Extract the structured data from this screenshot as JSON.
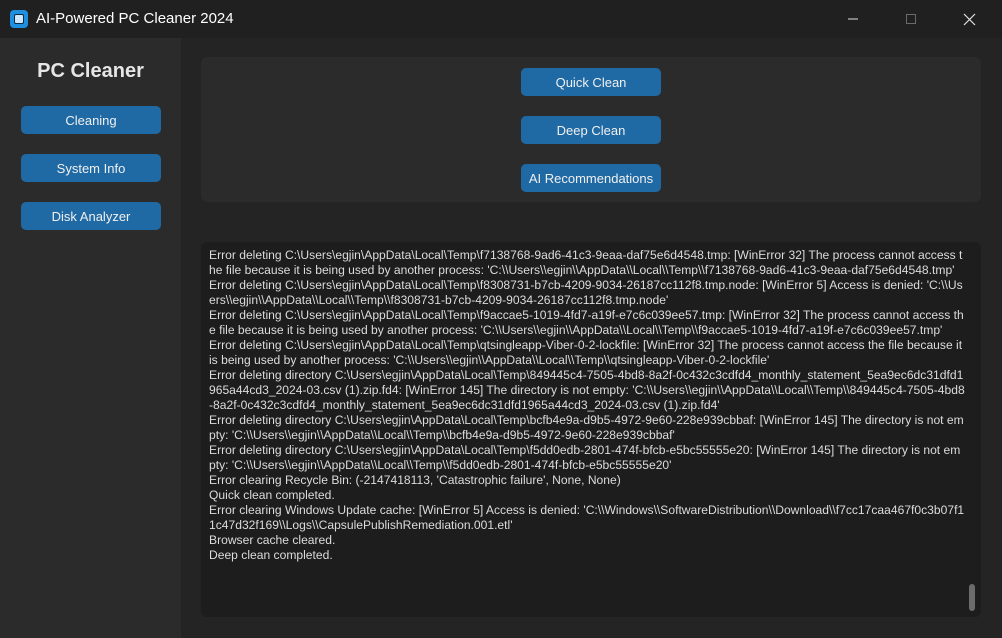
{
  "window": {
    "title": "AI-Powered PC Cleaner 2024"
  },
  "sidebar": {
    "title": "PC Cleaner",
    "items": [
      {
        "label": "Cleaning"
      },
      {
        "label": "System Info"
      },
      {
        "label": "Disk Analyzer"
      }
    ]
  },
  "main": {
    "buttons": [
      {
        "label": "Quick Clean"
      },
      {
        "label": "Deep Clean"
      },
      {
        "label": "AI Recommendations"
      }
    ]
  },
  "log": {
    "text": "Error deleting C:\\Users\\egjin\\AppData\\Local\\Temp\\f7138768-9ad6-41c3-9eaa-daf75e6d4548.tmp: [WinError 32] The process cannot access the file because it is being used by another process: 'C:\\\\Users\\\\egjin\\\\AppData\\\\Local\\\\Temp\\\\f7138768-9ad6-41c3-9eaa-daf75e6d4548.tmp'\nError deleting C:\\Users\\egjin\\AppData\\Local\\Temp\\f8308731-b7cb-4209-9034-26187cc112f8.tmp.node: [WinError 5] Access is denied: 'C:\\\\Users\\\\egjin\\\\AppData\\\\Local\\\\Temp\\\\f8308731-b7cb-4209-9034-26187cc112f8.tmp.node'\nError deleting C:\\Users\\egjin\\AppData\\Local\\Temp\\f9accae5-1019-4fd7-a19f-e7c6c039ee57.tmp: [WinError 32] The process cannot access the file because it is being used by another process: 'C:\\\\Users\\\\egjin\\\\AppData\\\\Local\\\\Temp\\\\f9accae5-1019-4fd7-a19f-e7c6c039ee57.tmp'\nError deleting C:\\Users\\egjin\\AppData\\Local\\Temp\\qtsingleapp-Viber-0-2-lockfile: [WinError 32] The process cannot access the file because it is being used by another process: 'C:\\\\Users\\\\egjin\\\\AppData\\\\Local\\\\Temp\\\\qtsingleapp-Viber-0-2-lockfile'\nError deleting directory C:\\Users\\egjin\\AppData\\Local\\Temp\\849445c4-7505-4bd8-8a2f-0c432c3cdfd4_monthly_statement_5ea9ec6dc31dfd1965a44cd3_2024-03.csv (1).zip.fd4: [WinError 145] The directory is not empty: 'C:\\\\Users\\\\egjin\\\\AppData\\\\Local\\\\Temp\\\\849445c4-7505-4bd8-8a2f-0c432c3cdfd4_monthly_statement_5ea9ec6dc31dfd1965a44cd3_2024-03.csv (1).zip.fd4'\nError deleting directory C:\\Users\\egjin\\AppData\\Local\\Temp\\bcfb4e9a-d9b5-4972-9e60-228e939cbbaf: [WinError 145] The directory is not empty: 'C:\\\\Users\\\\egjin\\\\AppData\\\\Local\\\\Temp\\\\bcfb4e9a-d9b5-4972-9e60-228e939cbbaf'\nError deleting directory C:\\Users\\egjin\\AppData\\Local\\Temp\\f5dd0edb-2801-474f-bfcb-e5bc55555e20: [WinError 145] The directory is not empty: 'C:\\\\Users\\\\egjin\\\\AppData\\\\Local\\\\Temp\\\\f5dd0edb-2801-474f-bfcb-e5bc55555e20'\nError clearing Recycle Bin: (-2147418113, 'Catastrophic failure', None, None)\nQuick clean completed.\nError clearing Windows Update cache: [WinError 5] Access is denied: 'C:\\\\Windows\\\\SoftwareDistribution\\\\Download\\\\f7cc17caa467f0c3b07f11c47d32f169\\\\Logs\\\\CapsulePublishRemediation.001.etl'\nBrowser cache cleared.\nDeep clean completed."
  },
  "icons": {
    "app": "app-icon",
    "minimize": "minimize-icon",
    "maximize": "maximize-icon",
    "close": "close-icon"
  },
  "colors": {
    "accent": "#1f6aa5",
    "background": "#242424",
    "panel": "#2b2b2b",
    "log_background": "#1d1d1d"
  }
}
